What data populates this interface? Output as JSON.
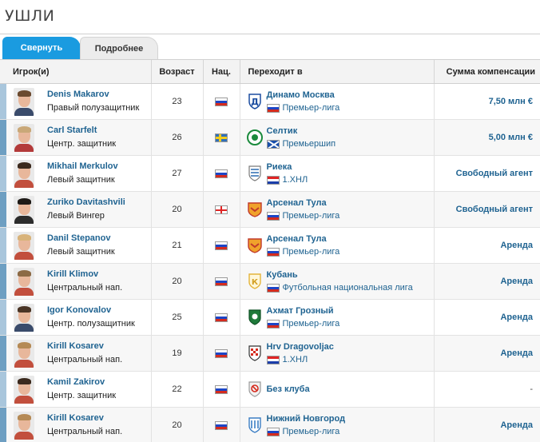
{
  "page_title": "УШЛИ",
  "tabs": {
    "collapse": "Свернуть",
    "details": "Подробнее"
  },
  "headers": {
    "player": "Игрок(и)",
    "age": "Возраст",
    "nat": "Нац.",
    "dest": "Переходит в",
    "fee": "Сумма компенсации"
  },
  "colors": {
    "accent": "#1a9be0",
    "link": "#1f6391",
    "stripe_a": "#a9c6dc",
    "stripe_b": "#6e9fc2"
  },
  "rows": [
    {
      "name": "Denis Makarov",
      "pos": "Правый полузащитник",
      "age": "23",
      "flag": "ru",
      "club": "Динамо Москва",
      "club_icon": "dinamo-moscow-crest-icon",
      "league_flag": "ru",
      "league": "Премьер-лига",
      "fee": "7,50 млн €",
      "hair": "#6b4a2f",
      "kit": "#3a4b6b"
    },
    {
      "name": "Carl Starfelt",
      "pos": "Центр. защитник",
      "age": "26",
      "flag": "se",
      "club": "Селтик",
      "club_icon": "celtic-crest-icon",
      "league_flag": "sc",
      "league": "Премьершип",
      "fee": "5,00 млн €",
      "hair": "#c9a878",
      "kit": "#b33a3a"
    },
    {
      "name": "Mikhail Merkulov",
      "pos": "Левый защитник",
      "age": "27",
      "flag": "ru",
      "club": "Риека",
      "club_icon": "rijeka-crest-icon",
      "league_flag": "hr",
      "league": "1.ХНЛ",
      "fee": "Свободный агент",
      "hair": "#3b2a1e",
      "kit": "#c24f3d"
    },
    {
      "name": "Zuriko Davitashvili",
      "pos": "Левый Вингер",
      "age": "20",
      "flag": "ge",
      "club": "Арсенал Тула",
      "club_icon": "arsenal-tula-crest-icon",
      "league_flag": "ru",
      "league": "Премьер-лига",
      "fee": "Свободный агент",
      "hair": "#1e1a17",
      "kit": "#2c2c2c"
    },
    {
      "name": "Danil Stepanov",
      "pos": "Левый защитник",
      "age": "21",
      "flag": "ru",
      "club": "Арсенал Тула",
      "club_icon": "arsenal-tula-crest-icon",
      "league_flag": "ru",
      "league": "Премьер-лига",
      "fee": "Аренда",
      "hair": "#d8b37a",
      "kit": "#c24f3d"
    },
    {
      "name": "Kirill Klimov",
      "pos": "Центральный нап.",
      "age": "20",
      "flag": "ru",
      "club": "Кубань",
      "club_icon": "kuban-crest-icon",
      "league_flag": "ru",
      "league": "Футбольная национальная лига",
      "fee": "Аренда",
      "hair": "#8c6a45",
      "kit": "#c24f3d"
    },
    {
      "name": "Igor Konovalov",
      "pos": "Центр. полузащитник",
      "age": "25",
      "flag": "ru",
      "club": "Ахмат Грозный",
      "club_icon": "akhmat-crest-icon",
      "league_flag": "ru",
      "league": "Премьер-лига",
      "fee": "Аренда",
      "hair": "#4a3526",
      "kit": "#3a4b6b"
    },
    {
      "name": "Kirill Kosarev",
      "pos": "Центральный нап.",
      "age": "19",
      "flag": "ru",
      "club": "Hrv Dragovoljac",
      "club_icon": "dragovoljac-crest-icon",
      "league_flag": "hr",
      "league": "1.ХНЛ",
      "fee": "Аренда",
      "hair": "#b58a55",
      "kit": "#c24f3d"
    },
    {
      "name": "Kamil Zakirov",
      "pos": "Центр. защитник",
      "age": "22",
      "flag": "ru",
      "club": "Без клуба",
      "club_icon": "no-club-icon",
      "league_flag": "",
      "league": "",
      "fee": "-",
      "hair": "#3b2a1e",
      "kit": "#c24f3d"
    },
    {
      "name": "Kirill Kosarev",
      "pos": "Центральный нап.",
      "age": "20",
      "flag": "ru",
      "club": "Нижний Новгород",
      "club_icon": "nizhny-novgorod-crest-icon",
      "league_flag": "ru",
      "league": "Премьер-лига",
      "fee": "Аренда",
      "hair": "#b58a55",
      "kit": "#c24f3d"
    }
  ]
}
